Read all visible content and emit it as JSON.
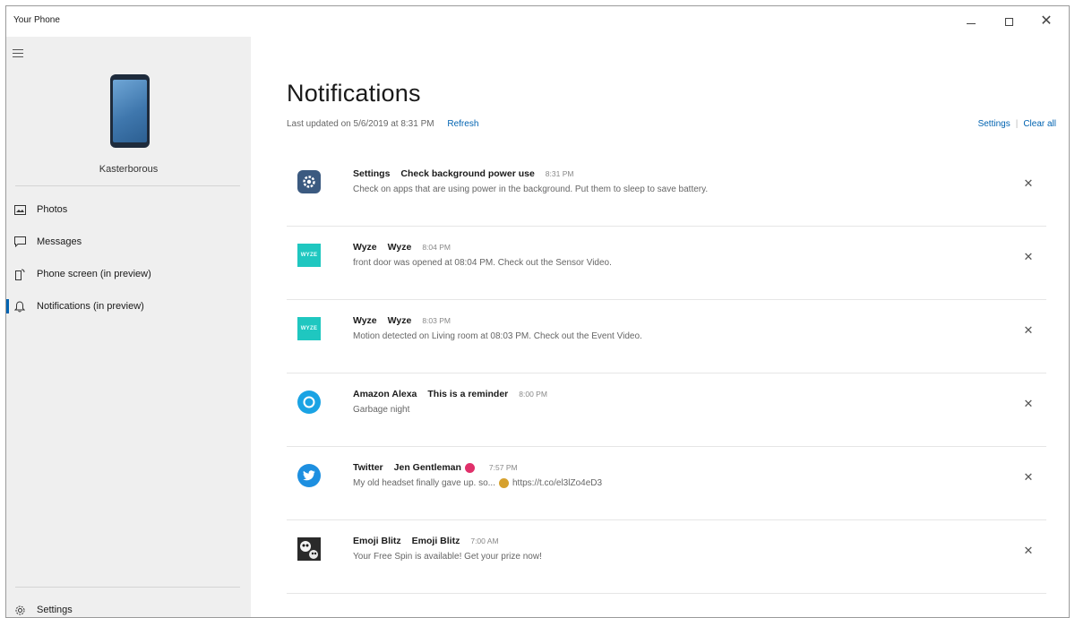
{
  "window": {
    "title": "Your Phone"
  },
  "sidebar": {
    "device_name": "Kasterborous",
    "items": [
      {
        "label": "Photos",
        "icon": "photos-icon"
      },
      {
        "label": "Messages",
        "icon": "messages-icon"
      },
      {
        "label": "Phone screen (in preview)",
        "icon": "phone-screen-icon"
      },
      {
        "label": "Notifications (in preview)",
        "icon": "bell-icon",
        "active": true
      }
    ],
    "settings_label": "Settings"
  },
  "main": {
    "title": "Notifications",
    "last_updated": "Last updated on 5/6/2019 at 8:31 PM",
    "refresh_label": "Refresh",
    "settings_link": "Settings",
    "separator": "|",
    "clear_all_link": "Clear all"
  },
  "notifications": [
    {
      "app": "Settings",
      "sender": "Check background power use",
      "time": "8:31 PM",
      "body": "Check on apps that are using power in the background. Put them to sleep to save battery.",
      "icon": "settings-app-icon"
    },
    {
      "app": "Wyze",
      "sender": "Wyze",
      "time": "8:04 PM",
      "body": "front door was opened at 08:04 PM. Check out the Sensor Video.",
      "icon": "wyze-app-icon",
      "icon_text": "WYZE"
    },
    {
      "app": "Wyze",
      "sender": "Wyze",
      "time": "8:03 PM",
      "body": "Motion detected on Living room at 08:03 PM. Check out the Event Video.",
      "icon": "wyze-app-icon",
      "icon_text": "WYZE"
    },
    {
      "app": "Amazon Alexa",
      "sender": "This is a reminder",
      "time": "8:00 PM",
      "body": "Garbage night",
      "icon": "alexa-app-icon"
    },
    {
      "app": "Twitter",
      "sender": "Jen Gentleman",
      "time": "7:57 PM",
      "body_prefix": "My old headset finally gave up. so...",
      "body_suffix": "https://t.co/el3lZo4eD3",
      "icon": "twitter-app-icon"
    },
    {
      "app": "Emoji Blitz",
      "sender": "Emoji Blitz",
      "time": "7:00 AM",
      "body": "Your Free Spin is available! Get your prize now!",
      "icon": "emoji-blitz-app-icon"
    }
  ],
  "dismiss_glyph": "✕",
  "colors": {
    "accent": "#0063b1",
    "sidebar_bg": "#efefef",
    "wyze": "#1fc7c0",
    "alexa": "#1aa3e4",
    "twitter": "#1d8fe0",
    "settings_icon": "#3b5a80"
  }
}
